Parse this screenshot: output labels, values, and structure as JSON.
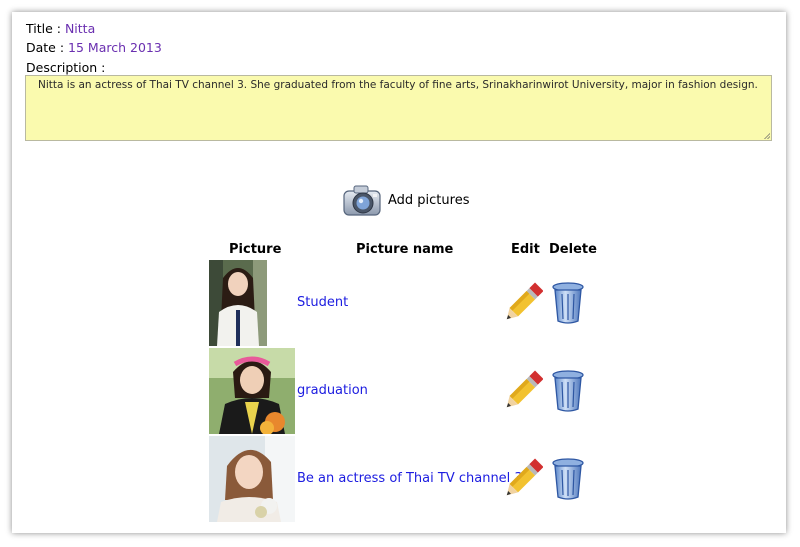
{
  "record": {
    "title_label": "Title : ",
    "title_value": "Nitta",
    "date_label": "Date : ",
    "date_value": "15 March 2013",
    "description_label": "Description :",
    "description_value": "Nitta is an actress of Thai TV channel 3. She graduated from the faculty of fine arts, Srinakharinwirot University, major in fashion design."
  },
  "add_pictures": {
    "label": "Add pictures",
    "icon": "camera-icon"
  },
  "table": {
    "headers": {
      "picture": "Picture",
      "name": "Picture name",
      "edit": "Edit",
      "delete": "Delete"
    },
    "rows": [
      {
        "name": "Student",
        "edit_icon": "pencil-icon",
        "delete_icon": "trash-can-icon"
      },
      {
        "name": "graduation",
        "edit_icon": "pencil-icon",
        "delete_icon": "trash-can-icon"
      },
      {
        "name": "Be an actress of Thai TV channel 3.",
        "edit_icon": "pencil-icon",
        "delete_icon": "trash-can-icon"
      }
    ]
  },
  "colors": {
    "value_text": "#6a2fb0",
    "link": "#1c1ce0",
    "description_bg": "#fafaae"
  }
}
